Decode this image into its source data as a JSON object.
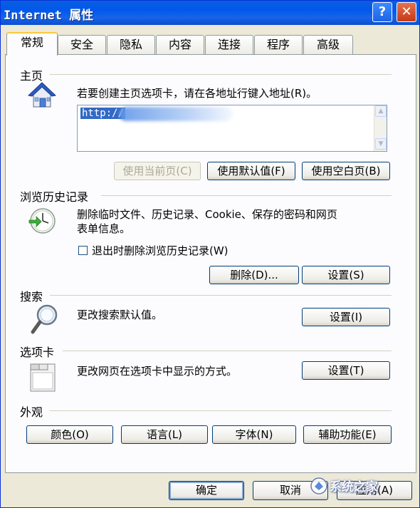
{
  "window": {
    "title": "Internet 属性",
    "help_label": "?",
    "close_label": "✕"
  },
  "tabs": [
    {
      "label": "常规",
      "active": true
    },
    {
      "label": "安全"
    },
    {
      "label": "隐私"
    },
    {
      "label": "内容"
    },
    {
      "label": "连接"
    },
    {
      "label": "程序"
    },
    {
      "label": "高级"
    }
  ],
  "homepage": {
    "section_title": "主页",
    "instruction": "若要创建主页选项卡，请在各地址行键入地址(R)。",
    "url_value": "http://",
    "use_current": "使用当前页(C)",
    "use_default": "使用默认值(F)",
    "use_blank": "使用空白页(B)"
  },
  "history": {
    "section_title": "浏览历史记录",
    "description_line1": "删除临时文件、历史记录、Cookie、保存的密码和网页",
    "description_line2": "表单信息。",
    "checkbox_label": "退出时删除浏览历史记录(W)",
    "delete_button": "删除(D)...",
    "settings_button": "设置(S)"
  },
  "search": {
    "section_title": "搜索",
    "description": "更改搜索默认值。",
    "settings_button": "设置(I)"
  },
  "tabs_section": {
    "section_title": "选项卡",
    "description": "更改网页在选项卡中显示的方式。",
    "settings_button": "设置(T)"
  },
  "appearance": {
    "section_title": "外观",
    "colors": "颜色(O)",
    "languages": "语言(L)",
    "fonts": "字体(N)",
    "accessibility": "辅助功能(E)"
  },
  "footer": {
    "ok": "确定",
    "cancel": "取消",
    "apply": "应用(A)"
  },
  "watermark": {
    "text": "系统之家"
  },
  "colors": {
    "titlebar": "#0058ee",
    "dialog_bg": "#ece9d8",
    "panel_bg": "#fcfcfe",
    "selection": "#3169c6"
  }
}
